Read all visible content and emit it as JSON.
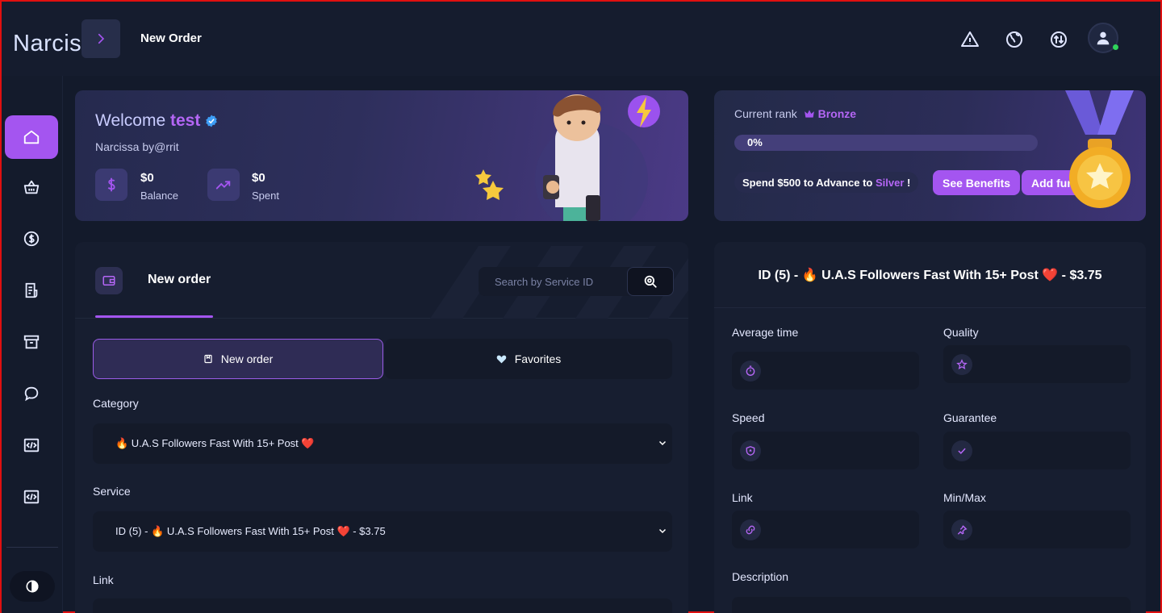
{
  "app": {
    "brand": "Narcissa",
    "page_title": "New Order"
  },
  "topbar": {
    "icons": [
      "warning-icon",
      "globe-icon",
      "currency-exchange-icon",
      "user-avatar-icon"
    ]
  },
  "sidebar": {
    "items": [
      {
        "icon": "home-icon",
        "active": true
      },
      {
        "icon": "basket-icon",
        "active": false
      },
      {
        "icon": "dollar-circle-icon",
        "active": false
      },
      {
        "icon": "receipt-icon",
        "active": false
      },
      {
        "icon": "archive-icon",
        "active": false
      },
      {
        "icon": "chat-bubble-icon",
        "active": false
      },
      {
        "icon": "code-icon",
        "active": false
      },
      {
        "icon": "code-icon",
        "active": false
      }
    ],
    "theme_icon": "theme-toggle-icon"
  },
  "welcome": {
    "greeting": "Welcome",
    "username": "test",
    "subtitle": "Narcissa by@rrit",
    "balance_value": "$0",
    "balance_label": "Balance",
    "spent_value": "$0",
    "spent_label": "Spent"
  },
  "rank": {
    "label": "Current rank",
    "name": "Bronze",
    "progress_text": "0%",
    "progress": 0,
    "advance_prefix": "Spend $500 to Advance to",
    "advance_target": "Silver",
    "advance_suffix": "!",
    "benefits_button": "See Benefits",
    "add_funds_button": "Add funds"
  },
  "order_panel": {
    "title": "New order",
    "search_placeholder": "Search by Service ID",
    "tab_new_order": "New order",
    "tab_favorites": "Favorites",
    "category_label": "Category",
    "category_value": "🔥 U.A.S Followers Fast With 15+ Post ❤️",
    "service_label": "Service",
    "service_value": "ID (5) - 🔥 U.A.S Followers Fast With 15+ Post ❤️ - $3.75",
    "link_label": "Link"
  },
  "service_details": {
    "title": "ID (5) - 🔥 U.A.S Followers Fast With 15+ Post ❤️ - $3.75",
    "average_time_label": "Average time",
    "quality_label": "Quality",
    "speed_label": "Speed",
    "guarantee_label": "Guarantee",
    "link_label": "Link",
    "minmax_label": "Min/Max",
    "description_label": "Description"
  },
  "colors": {
    "accent": "#a455f0",
    "background": "#131a2b",
    "card": "#171e30"
  }
}
